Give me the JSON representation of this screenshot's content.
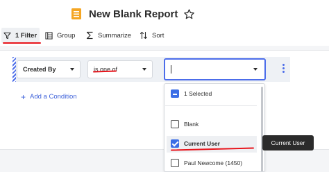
{
  "report": {
    "title": "New Blank Report"
  },
  "toolbar": {
    "filter_label": "1 Filter",
    "group_label": "Group",
    "summarize_label": "Summarize",
    "sort_label": "Sort"
  },
  "filter": {
    "field": "Created By",
    "operator": "is one of",
    "value": ""
  },
  "add_condition_label": "Add a Condition",
  "dropdown": {
    "selected_summary": "1 Selected",
    "options": [
      {
        "label": "Blank",
        "checked": false
      },
      {
        "label": "Current User",
        "checked": true
      },
      {
        "label": "Paul Newcome (1450)",
        "checked": false
      }
    ]
  },
  "tooltip": "Current User",
  "colors": {
    "accent": "#4c6dea",
    "annotation": "#e8141b",
    "checkbox": "#3b6ee6",
    "report_icon": "#f5a623"
  },
  "icons": [
    "report-icon",
    "star-icon",
    "filter-icon",
    "group-icon",
    "summarize-icon",
    "sort-icon",
    "kebab-icon",
    "plus-icon"
  ]
}
